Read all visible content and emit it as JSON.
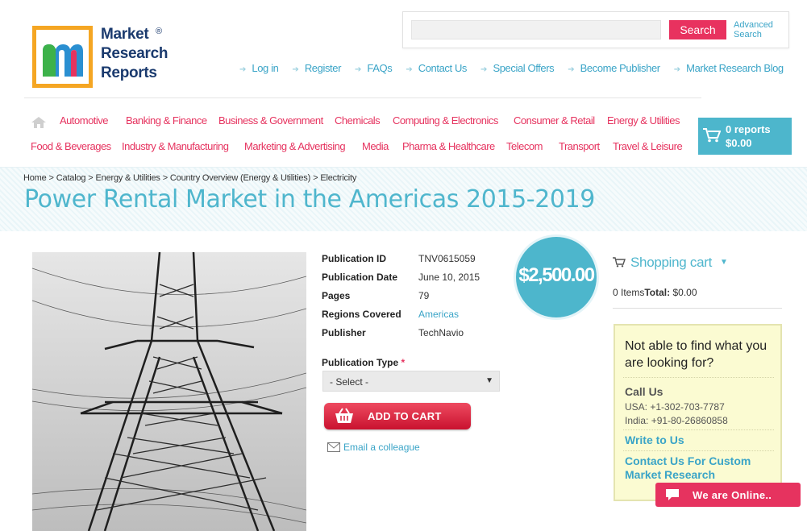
{
  "brand": {
    "logo_text_line1": "Market",
    "logo_text_line2": "Research",
    "logo_text_line3": "Reports",
    "registered": "®"
  },
  "search": {
    "placeholder": "",
    "button_label": "Search",
    "advanced_label_line1": "Advanced",
    "advanced_label_line2": "Search"
  },
  "toplinks": [
    "Log in",
    "Register",
    "FAQs",
    "Contact Us",
    "Special Offers",
    "Become Publisher",
    "Market Research Blog"
  ],
  "categories": {
    "row1": [
      "Automotive",
      "Banking & Finance",
      "Business & Government",
      "Chemicals",
      "Computing & Electronics",
      "Consumer & Retail",
      "Energy & Utilities"
    ],
    "row2": [
      "Food & Beverages",
      "Industry & Manufacturing",
      "Marketing & Advertising",
      "Media",
      "Pharma & Healthcare",
      "Telecom",
      "Transport",
      "Travel & Leisure"
    ]
  },
  "header_cart": {
    "count": "0 reports",
    "total": "$0.00"
  },
  "breadcrumb": [
    "Home",
    "Catalog",
    "Energy & Utilities",
    "Country Overview (Energy & Utilities)",
    "Electricity"
  ],
  "breadcrumb_sep": ">",
  "page_title": "Power Rental Market in the Americas 2015-2019",
  "product": {
    "details": [
      {
        "label": "Publication ID",
        "value": "TNV0615059"
      },
      {
        "label": "Publication Date",
        "value": "June 10, 2015"
      },
      {
        "label": "Pages",
        "value": "79"
      },
      {
        "label": "Regions Covered",
        "value": "Americas"
      },
      {
        "label": "Publisher",
        "value": "TechNavio"
      }
    ],
    "price": "$2,500.00",
    "pub_type_label": "Publication Type",
    "required_mark": "*",
    "select_value": "- Select -",
    "add_to_cart": "ADD TO CART",
    "email_colleague": "Email a colleague"
  },
  "sidebar": {
    "cart_title": "Shopping cart",
    "items_label": "0 Items",
    "total_label": "Total:",
    "total_value": "$0.00",
    "help_title": "Not able to find what you are looking for?",
    "call_us": "Call Us",
    "phone_usa": "USA: +1-302-703-7787",
    "phone_india": "India: +91-80-26860858",
    "write_to_us": "Write to Us",
    "custom_research": "Contact Us For Custom Market Research"
  },
  "chat": {
    "label": "We are Online.."
  },
  "colors": {
    "accent_teal": "#4db6cc",
    "accent_pink": "#e6335f",
    "help_bg": "#fbfbd2"
  }
}
